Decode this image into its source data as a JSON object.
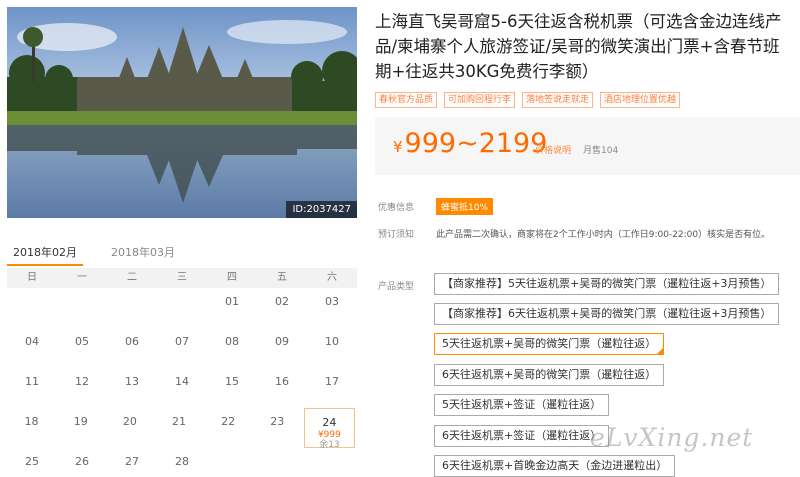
{
  "photo": {
    "id_label": "ID:2037427"
  },
  "calendar": {
    "tabs": [
      {
        "label": "2018年02月",
        "active": true
      },
      {
        "label": "2018年03月",
        "active": false
      }
    ],
    "weekdays": [
      "日",
      "一",
      "二",
      "三",
      "四",
      "五",
      "六"
    ],
    "rows": [
      [
        "",
        "",
        "",
        "",
        "01",
        "02",
        "03"
      ],
      [
        "04",
        "05",
        "06",
        "07",
        "08",
        "09",
        "10"
      ],
      [
        "11",
        "12",
        "13",
        "14",
        "15",
        "16",
        "17"
      ],
      [
        "18",
        "19",
        "20",
        "21",
        "22",
        "23",
        "24"
      ],
      [
        "25",
        "26",
        "27",
        "28",
        "",
        "",
        ""
      ]
    ],
    "available_day": {
      "day": "24",
      "price": "¥999",
      "stock": "余13"
    }
  },
  "product": {
    "title": "上海直飞吴哥窟5-6天往返含税机票（可选含金边连线产品/柬埔寨个人旅游签证/吴哥的微笑演出门票+含春节班期+往返共30KG免费行李额）",
    "tags": [
      "春秋官方品质",
      "可加购回程行李",
      "落地签说走就走",
      "酒店地理位置优越"
    ],
    "price": {
      "currency": "¥",
      "range": "999~2199",
      "note_link": "价格说明",
      "sales": "月售104"
    },
    "discount_label": "优惠信息",
    "discount_badge": "蜂蜜抵10%",
    "booking_label": "预订须知",
    "booking_note": "此产品需二次确认，商家将在2个工作小时内（工作日9:00-22:00）核实是否有位。",
    "options_label": "产品类型",
    "options": [
      {
        "label": "【商家推荐】5天往返机票+吴哥的微笑门票（暹粒往返+3月预售）",
        "selected": false
      },
      {
        "label": "【商家推荐】6天往返机票+吴哥的微笑门票（暹粒往返+3月预售）",
        "selected": false
      },
      {
        "label": "5天往返机票+吴哥的微笑门票（暹粒往返）",
        "selected": true
      },
      {
        "label": "6天往返机票+吴哥的微笑门票（暹粒往返）",
        "selected": false
      },
      {
        "label": "5天往返机票+签证（暹粒往返）",
        "selected": false
      },
      {
        "label": "6天往返机票+签证（暹粒往返）",
        "selected": false
      },
      {
        "label": "6天往返机票+首晚金边高天（金边进暹粒出）",
        "selected": false
      }
    ]
  },
  "watermark": "eLvXing.net",
  "colors": {
    "accent": "#ff8a00",
    "price": "#ff6a00"
  }
}
